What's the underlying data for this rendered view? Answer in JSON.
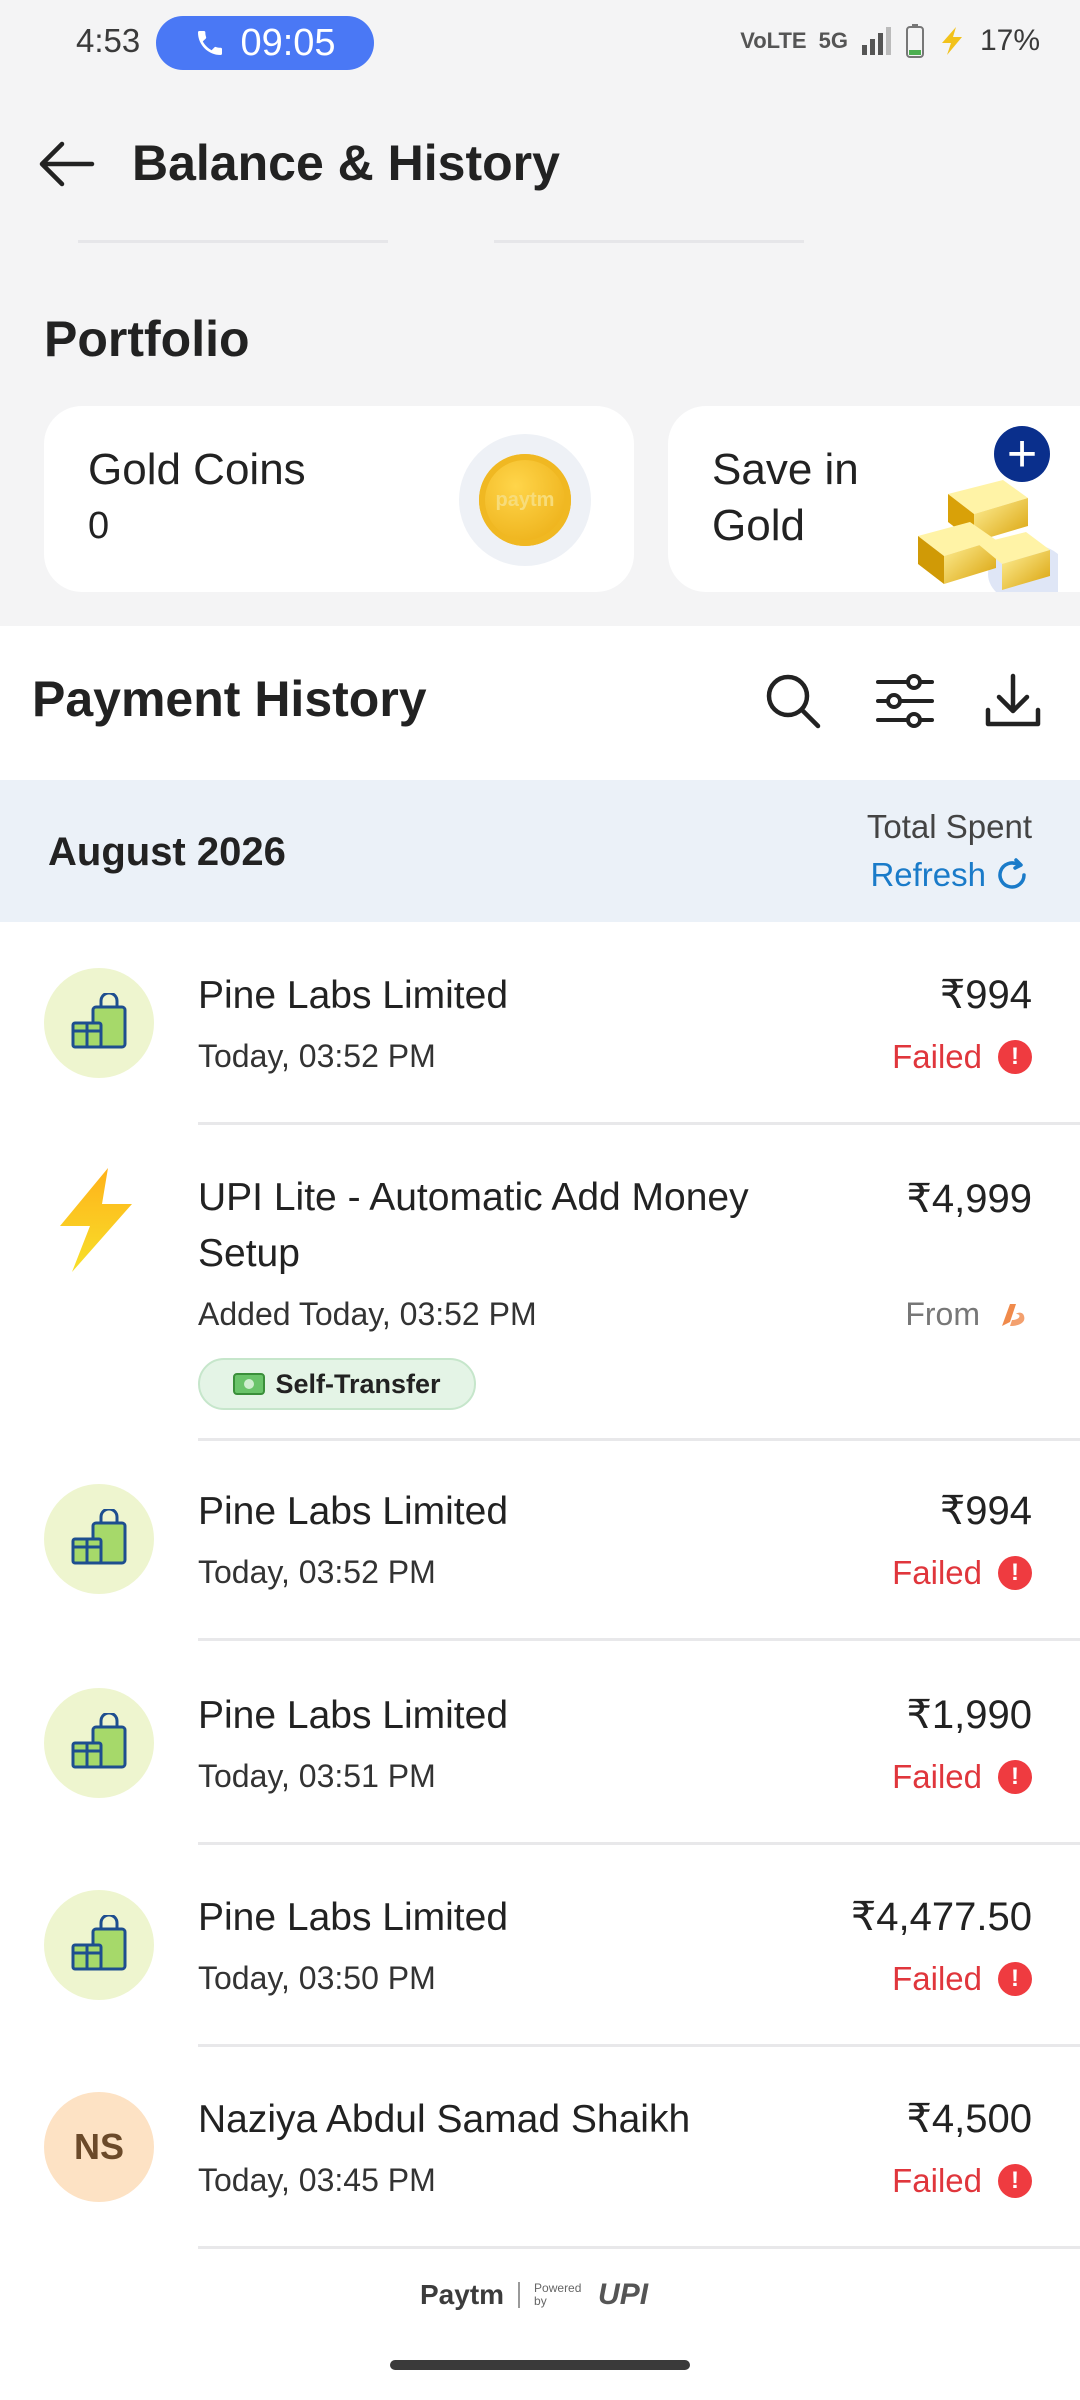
{
  "status_bar": {
    "time": "4:53",
    "call_timer": "09:05",
    "network": "5G",
    "battery": "17%"
  },
  "header": {
    "title": "Balance & History"
  },
  "portfolio": {
    "title": "Portfolio",
    "gold_coins": {
      "label": "Gold Coins",
      "value": "0",
      "coin_text": "paytm"
    },
    "save_gold": {
      "label_line1": "Save in",
      "label_line2": "Gold"
    }
  },
  "payment_history": {
    "title": "Payment History"
  },
  "month": {
    "label": "August 2026",
    "total_spent": "Total Spent",
    "refresh": "Refresh"
  },
  "transactions": [
    {
      "name": "Pine Labs Limited",
      "time": "Today, 03:52 PM",
      "amount": "₹994",
      "status": "Failed"
    },
    {
      "name_line1": "UPI Lite - Automatic Add Money",
      "name_line2": "Setup",
      "time": "Added Today, 03:52 PM",
      "amount": "₹4,999",
      "from": "From",
      "tag": "Self-Transfer"
    },
    {
      "name": "Pine Labs Limited",
      "time": "Today, 03:52 PM",
      "amount": "₹994",
      "status": "Failed"
    },
    {
      "name": "Pine Labs Limited",
      "time": "Today, 03:51 PM",
      "amount": "₹1,990",
      "status": "Failed"
    },
    {
      "name": "Pine Labs Limited",
      "time": "Today, 03:50 PM",
      "amount": "₹4,477.50",
      "status": "Failed"
    },
    {
      "name": "Naziya Abdul Samad Shaikh",
      "initials": "NS",
      "time": "Today, 03:45 PM",
      "amount": "₹4,500",
      "status": "Failed"
    }
  ],
  "footer": {
    "brand": "Paytm",
    "powered_by": "Powered by",
    "upi": "UPI"
  },
  "colors": {
    "accent": "#1a7bc9",
    "failed": "#e0363c",
    "call_pill": "#4a78f5",
    "month_band": "#ebf1f8"
  },
  "icons": [
    "back-arrow-icon",
    "search-icon",
    "filter-icon",
    "download-icon",
    "shopping-bag-icon",
    "lightning-icon",
    "alert-icon",
    "refresh-icon",
    "bank-icon",
    "phone-icon",
    "gold-bar-icon",
    "plus-icon"
  ]
}
